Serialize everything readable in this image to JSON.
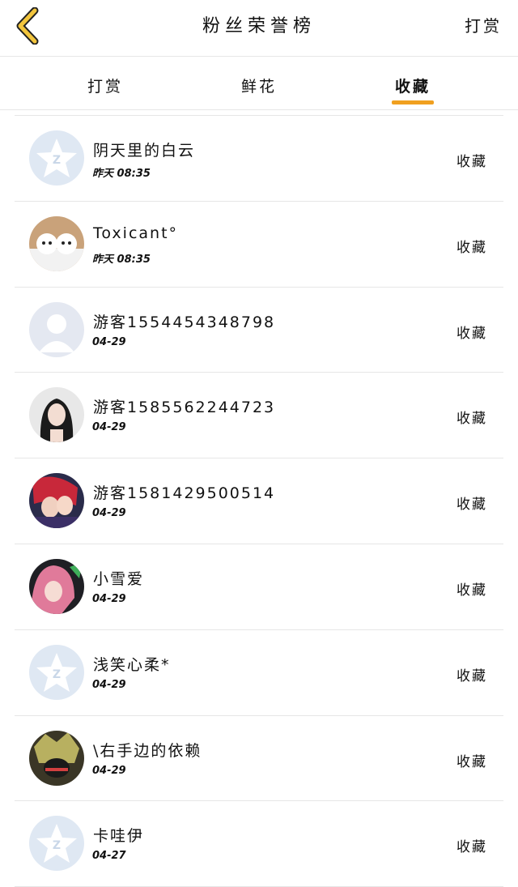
{
  "header": {
    "title": "粉丝荣誉榜",
    "reward_link": "打赏"
  },
  "tabs": [
    {
      "label": "打赏"
    },
    {
      "label": "鲜花"
    },
    {
      "label": "收藏"
    }
  ],
  "colors": {
    "accent": "#f0a020",
    "back_icon": "#f2c53d"
  },
  "fans": [
    {
      "name": "阴天里的白云",
      "time": "昨天 08:35",
      "action": "收藏",
      "avatar": "default-star-avatar"
    },
    {
      "name": "Toxicant°",
      "time": "昨天 08:35",
      "action": "收藏",
      "avatar": "photo-dogs-avatar"
    },
    {
      "name": "游客1554454348798",
      "time": "04-29",
      "action": "收藏",
      "avatar": "blank-person-avatar"
    },
    {
      "name": "游客1585562244723",
      "time": "04-29",
      "action": "收藏",
      "avatar": "photo-woman-avatar"
    },
    {
      "name": "游客1581429500514",
      "time": "04-29",
      "action": "收藏",
      "avatar": "anime-couple-avatar"
    },
    {
      "name": "小雪爱",
      "time": "04-29",
      "action": "收藏",
      "avatar": "anime-pink-hair-avatar"
    },
    {
      "name": "浅笑心柔*",
      "time": "04-29",
      "action": "收藏",
      "avatar": "default-star-avatar"
    },
    {
      "name": "\\右手边的依赖",
      "time": "04-29",
      "action": "收藏",
      "avatar": "anime-dark-avatar"
    },
    {
      "name": "卡哇伊",
      "time": "04-27",
      "action": "收藏",
      "avatar": "default-star-avatar"
    }
  ]
}
